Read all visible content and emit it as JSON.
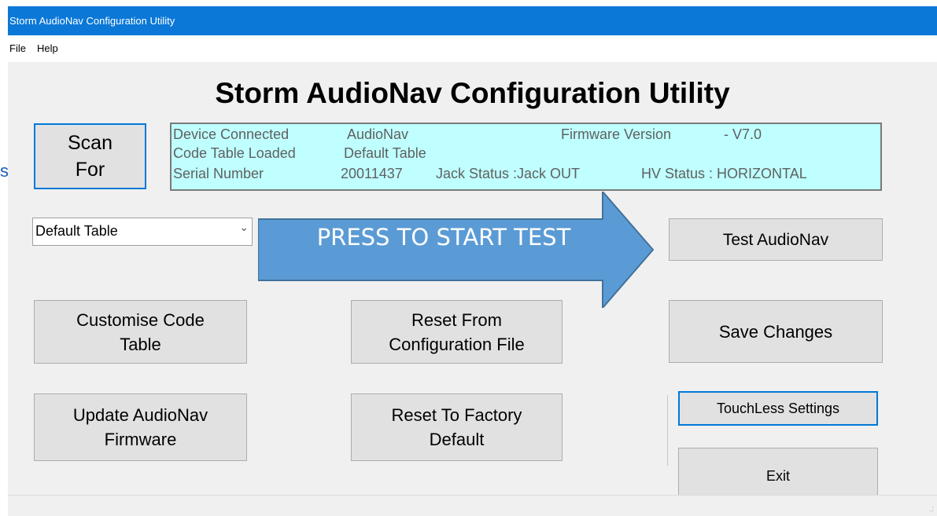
{
  "window": {
    "title": "Storm AudioNav Configuration Utility"
  },
  "menu": {
    "items": [
      "File",
      "Help"
    ]
  },
  "heading": "Storm AudioNav Configuration Utility",
  "scan_button": {
    "label": "Scan\nFor"
  },
  "device_info": {
    "device_connected_label": "Device Connected",
    "device_connected_value": "AudioNav",
    "firmware_version_label": "Firmware Version",
    "firmware_version_value": "-  V7.0",
    "code_table_label": "Code Table Loaded",
    "code_table_value": "Default Table",
    "serial_number_label": "Serial Number",
    "serial_number_value": "20011437",
    "jack_status": "Jack Status :Jack OUT",
    "hv_status": "HV Status : HORIZONTAL"
  },
  "code_table_select": {
    "selected": "Default Table"
  },
  "callout": {
    "text": "PRESS TO START TEST",
    "color": "#5b9bd5"
  },
  "buttons": {
    "test_audionav": "Test AudioNav",
    "customise_code_table": "Customise Code\nTable",
    "reset_from_config": "Reset From\nConfiguration File",
    "save_changes": "Save Changes",
    "update_firmware": "Update AudioNav\nFirmware",
    "reset_factory": "Reset To Factory\nDefault",
    "touchless_settings": "TouchLess Settings",
    "exit": "Exit"
  },
  "edge_glyph": "s",
  "colors": {
    "title_bar": "#0b78d7",
    "info_panel_bg": "#bfffff",
    "focus_border": "#0078d7"
  }
}
